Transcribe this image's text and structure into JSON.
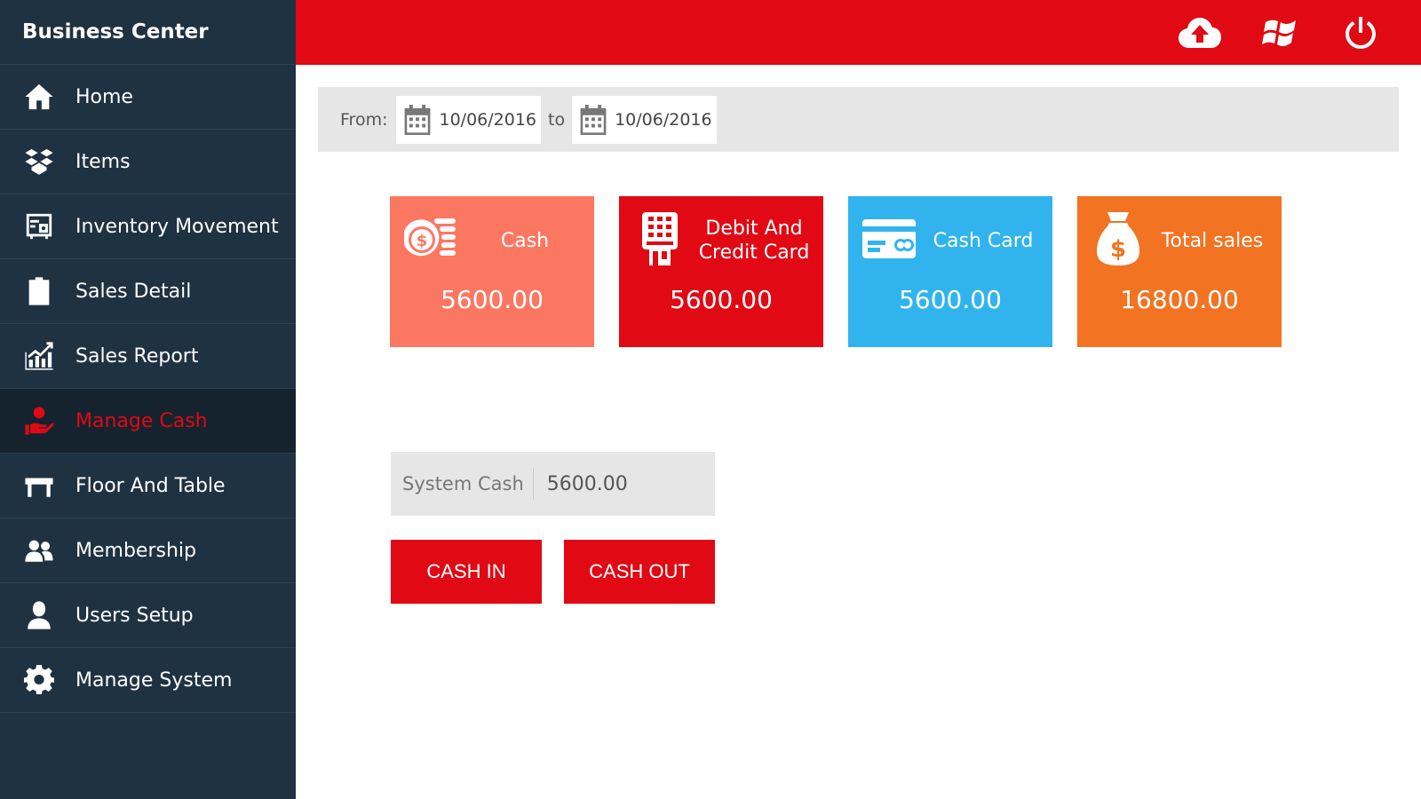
{
  "app": {
    "brand": "Business Center"
  },
  "sidebar": {
    "items": [
      {
        "label": "Home",
        "icon": "home-icon"
      },
      {
        "label": "Items",
        "icon": "boxes-icon"
      },
      {
        "label": "Inventory Movement",
        "icon": "safe-icon"
      },
      {
        "label": "Sales Detail",
        "icon": "clipboard-icon"
      },
      {
        "label": "Sales Report",
        "icon": "chart-icon"
      },
      {
        "label": "Manage Cash",
        "icon": "hand-coin-icon",
        "active": true
      },
      {
        "label": "Floor And Table",
        "icon": "table-icon"
      },
      {
        "label": "Membership",
        "icon": "users-icon"
      },
      {
        "label": "Users Setup",
        "icon": "user-icon"
      },
      {
        "label": "Manage System",
        "icon": "gear-icon"
      }
    ]
  },
  "topbar": {
    "icons": [
      "cloud-upload-icon",
      "windows-icon",
      "power-icon"
    ]
  },
  "filter": {
    "from_label": "From:",
    "from_date": "10/06/2016",
    "to_label": "to",
    "to_date": "10/06/2016"
  },
  "cards": {
    "cash": {
      "title": "Cash",
      "value": "5600.00",
      "icon": "coins-icon"
    },
    "debit": {
      "title": "Debit And Credit Card",
      "value": "5600.00",
      "icon": "card-terminal-icon"
    },
    "cash_card": {
      "title": "Cash Card",
      "value": "5600.00",
      "icon": "credit-card-icon"
    },
    "total": {
      "title": "Total sales",
      "value": "16800.00",
      "icon": "money-bag-icon"
    }
  },
  "system_cash": {
    "label": "System Cash",
    "value": "5600.00"
  },
  "actions": {
    "cash_in": "CASH IN",
    "cash_out": "CASH OUT"
  },
  "colors": {
    "accent_red": "#e00914",
    "sidebar_bg": "#1f3242",
    "cash_card_bg": "#fc7762",
    "debit_card_bg": "#e00914",
    "cash_card_blue": "#31b4ee",
    "total_sales_bg": "#f27322"
  }
}
